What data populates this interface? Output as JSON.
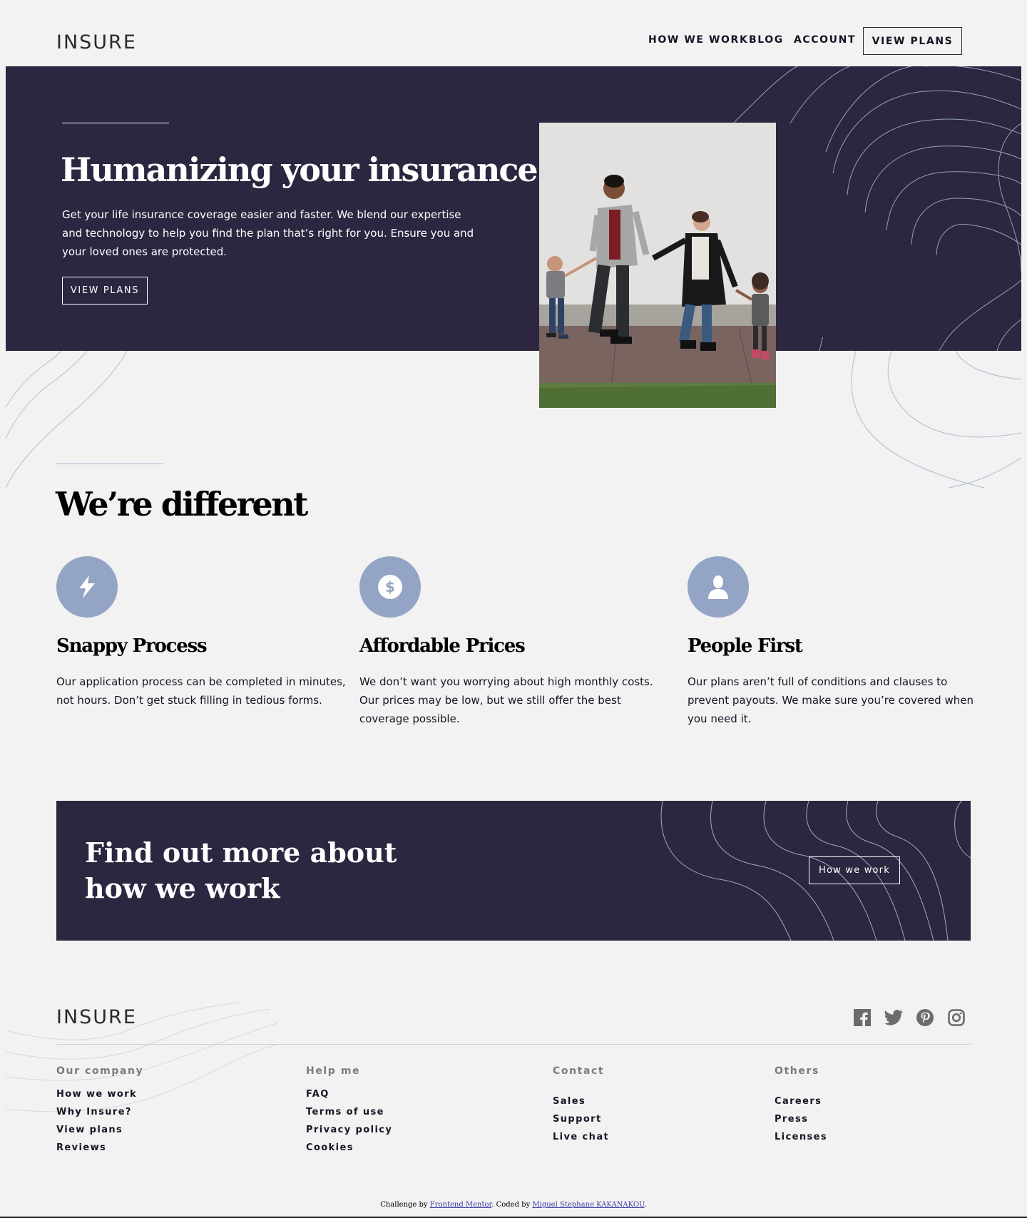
{
  "header": {
    "logo": "INSURE",
    "nav": [
      "HOW WE WORK",
      "BLOG",
      "ACCOUNT"
    ],
    "cta": "VIEW PLANS"
  },
  "hero": {
    "title": "Humanizing your insurance.",
    "text": "Get your life insurance coverage easier and faster. We blend our expertise and technology to help you find the plan that’s right for you. Ensure you and your loved ones are protected.",
    "button": "VIEW PLANS"
  },
  "different": {
    "title": "We’re different",
    "features": [
      {
        "icon": "lightning-icon",
        "title": "Snappy Process",
        "text": "Our application process can be completed in minutes, not hours. Don’t get stuck filling in tedious forms."
      },
      {
        "icon": "dollar-icon",
        "title": "Affordable Prices",
        "text": "We don’t want you worrying about high monthly costs. Our prices may be low, but we still offer the best coverage possible."
      },
      {
        "icon": "person-icon",
        "title": "People First",
        "text": "Our plans aren’t full of conditions and clauses to prevent payouts. We make sure you’re covered when you need it."
      }
    ]
  },
  "cta": {
    "title": "Find out more about how we work",
    "button": "How we work"
  },
  "footer": {
    "logo": "INSURE",
    "socials": [
      "facebook-icon",
      "twitter-icon",
      "pinterest-icon",
      "instagram-icon"
    ],
    "columns": [
      {
        "heading": "Our company",
        "links": [
          "How we work",
          "Why Insure?",
          "View plans",
          "Reviews"
        ]
      },
      {
        "heading": "Help me",
        "links": [
          "FAQ",
          "Terms of use",
          "Privacy policy",
          "Cookies"
        ]
      },
      {
        "heading": "Contact",
        "links": [
          "Sales",
          "Support",
          "Live chat"
        ]
      },
      {
        "heading": "Others",
        "links": [
          "Careers",
          "Press",
          "Licenses"
        ]
      }
    ],
    "credit": {
      "prefix": "Challenge by ",
      "link1": "Frontend Mentor",
      "middle": ". Coded by ",
      "link2": "Miguel Stephane KAKANAKOU",
      "suffix": "."
    }
  },
  "colors": {
    "dark_violet": "#2c2640",
    "page_bg": "#f2f2f2",
    "icon_bg": "#93a4c4",
    "pattern_line": "#a7b6d0"
  }
}
